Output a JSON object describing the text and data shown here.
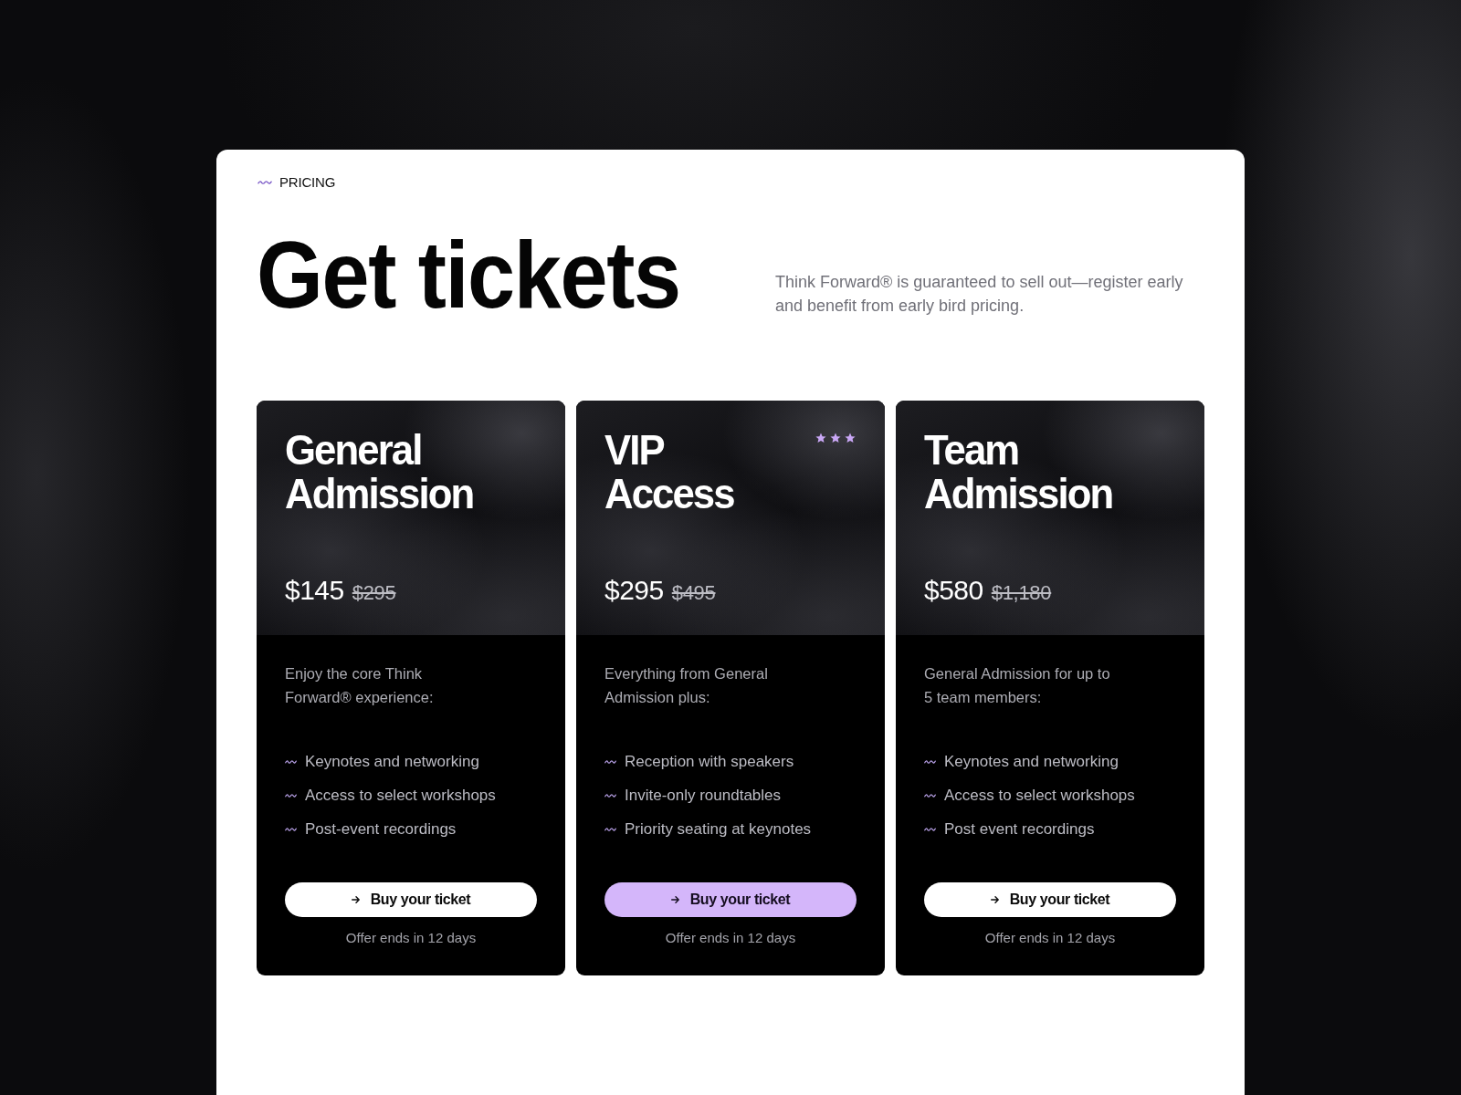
{
  "section_label": "PRICING",
  "heading": "Get tickets",
  "intro": "Think Forward® is guaranteed to sell out—register early and benefit from early bird pricing.",
  "plans": [
    {
      "name": "General Admission",
      "price": "$145",
      "old_price": "$295",
      "description": "Enjoy the core Think Forward® experience:",
      "features": [
        "Keynotes and networking",
        "Access to select workshops",
        "Post-event recordings"
      ],
      "featured": false,
      "button": "Buy your ticket",
      "note": "Offer ends in 12 days"
    },
    {
      "name": "VIP Access",
      "stars": 3,
      "price": "$295",
      "old_price": "$495",
      "description": "Everything from General Admission plus:",
      "features": [
        "Reception with speakers",
        "Invite-only roundtables",
        "Priority seating at keynotes"
      ],
      "featured": true,
      "button": "Buy your ticket",
      "note": "Offer ends in 12 days"
    },
    {
      "name": "Team Admission",
      "price": "$580",
      "old_price": "$1,180",
      "description": "General Admission for up to 5 team members:",
      "features": [
        "Keynotes and networking",
        "Access to select workshops",
        "Post event recordings"
      ],
      "featured": false,
      "button": "Buy your ticket",
      "note": "Offer ends in 12 days"
    }
  ]
}
